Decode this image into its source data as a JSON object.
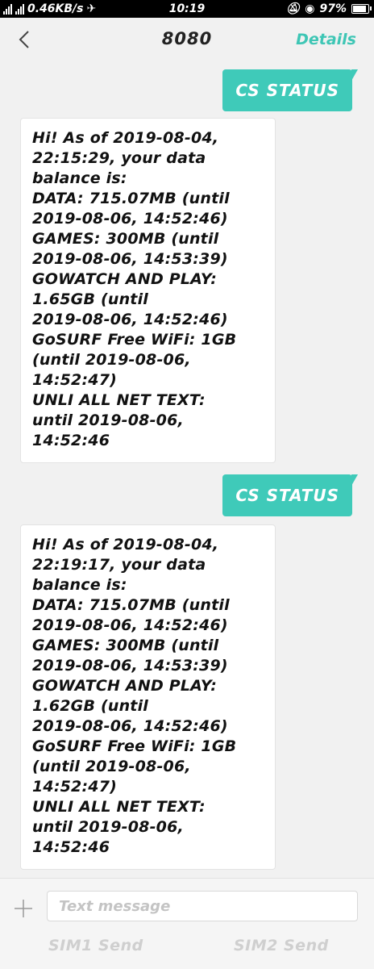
{
  "status_bar": {
    "speed": "0.46KB/s",
    "time": "10:19",
    "battery_percent": "97%",
    "battery_level": 0.97
  },
  "header": {
    "title": "8080",
    "details_label": "Details"
  },
  "messages": [
    {
      "direction": "sent",
      "text": "CS STATUS"
    },
    {
      "direction": "received",
      "lines": [
        "Hi! As of 2019-08-04,",
        "22:15:29, your data",
        "balance is:",
        "DATA: 715.07MB (until",
        "2019-08-06, 14:52:46)",
        "GAMES: 300MB (until",
        "2019-08-06, 14:53:39)",
        "GOWATCH AND PLAY:",
        "1.65GB (until",
        "2019-08-06, 14:52:46)",
        "GoSURF Free WiFi: 1GB",
        "(until 2019-08-06,",
        "14:52:47)",
        "UNLI ALL NET TEXT:",
        "until 2019-08-06,",
        "14:52:46"
      ]
    },
    {
      "direction": "sent",
      "text": "CS STATUS"
    },
    {
      "direction": "received",
      "lines": [
        "Hi! As of 2019-08-04,",
        "22:19:17, your data",
        "balance is:",
        "DATA: 715.07MB (until",
        "2019-08-06, 14:52:46)",
        "GAMES: 300MB (until",
        "2019-08-06, 14:53:39)",
        "GOWATCH AND PLAY:",
        "1.62GB (until",
        "2019-08-06, 14:52:46)",
        "GoSURF Free WiFi: 1GB",
        "(until 2019-08-06,",
        "14:52:47)",
        "UNLI ALL NET TEXT:",
        "until 2019-08-06,",
        "14:52:46"
      ]
    }
  ],
  "composer": {
    "placeholder": "Text message",
    "sim1_send": "SIM1 Send",
    "sim2_send": "SIM2 Send"
  }
}
